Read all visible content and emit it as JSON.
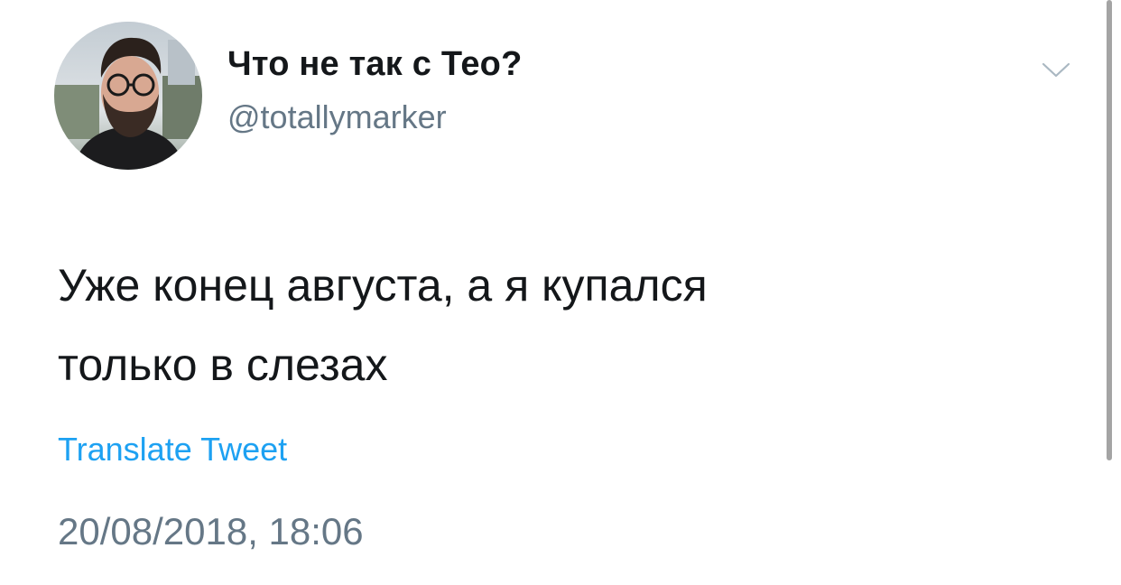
{
  "author": {
    "display_name": "Что не так с Тео?",
    "handle": "@totallymarker"
  },
  "tweet": {
    "text_lines": [
      "Уже конец августа, а я купался",
      "только в слезах"
    ],
    "translate_label": "Translate Tweet",
    "timestamp": "20/08/2018, 18:06"
  },
  "icons": {
    "menu": "chevron-down-icon"
  },
  "colors": {
    "primary_text": "#14171a",
    "secondary_text": "#657786",
    "link": "#1da1f2"
  }
}
